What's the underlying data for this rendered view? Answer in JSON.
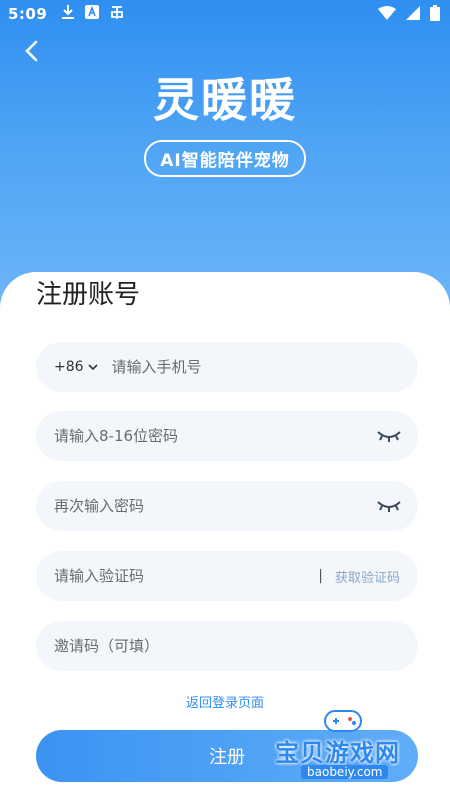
{
  "status_bar": {
    "time": "5:09"
  },
  "logo": {
    "title": "灵暖暖",
    "subtitle": "AI智能陪伴宠物"
  },
  "form": {
    "title": "注册账号",
    "phone": {
      "country_code": "+86",
      "placeholder": "请输入手机号"
    },
    "password": {
      "placeholder": "请输入8-16位密码"
    },
    "confirm_password": {
      "placeholder": "再次输入密码"
    },
    "verify_code": {
      "placeholder": "请输入验证码",
      "get_code_label": "获取验证码",
      "divider": "|"
    },
    "invite_code": {
      "placeholder": "邀请码（可填）"
    },
    "back_login_label": "返回登录页面",
    "submit_label": "注册"
  },
  "watermark": {
    "text": "宝贝游戏网",
    "url": "baobeiy.com"
  },
  "colors": {
    "primary": "#2f8ff0",
    "field_bg": "#f3f7fb",
    "link": "#2f8ff0"
  }
}
